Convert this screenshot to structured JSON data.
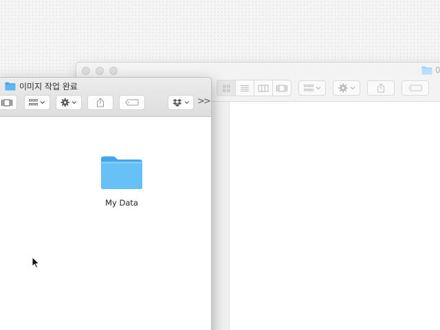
{
  "back_window": {
    "title": "0"
  },
  "front_window": {
    "title": "이미지 작업 완료",
    "items": [
      {
        "name": "My Data",
        "kind": "folder-icon"
      }
    ]
  },
  "icons": {
    "folder_color": "#5bb6f1",
    "folder_tab_color": "#7cc8f6",
    "dropbox_icon": "dropbox-icon",
    "action_icon": "gear-icon",
    "share_icon": "share-icon",
    "tag_icon": "tag-icon",
    "arrange_icon": "arrange-grid-icon",
    "overflow_icon": "toolbar-overflow-icon"
  },
  "colors": {
    "desktop_bg": "#f4f4f4",
    "titlebar_active": "#e4e4e4",
    "titlebar_inactive": "#f3f3f3",
    "traffic_light_inactive": "#dedede"
  }
}
